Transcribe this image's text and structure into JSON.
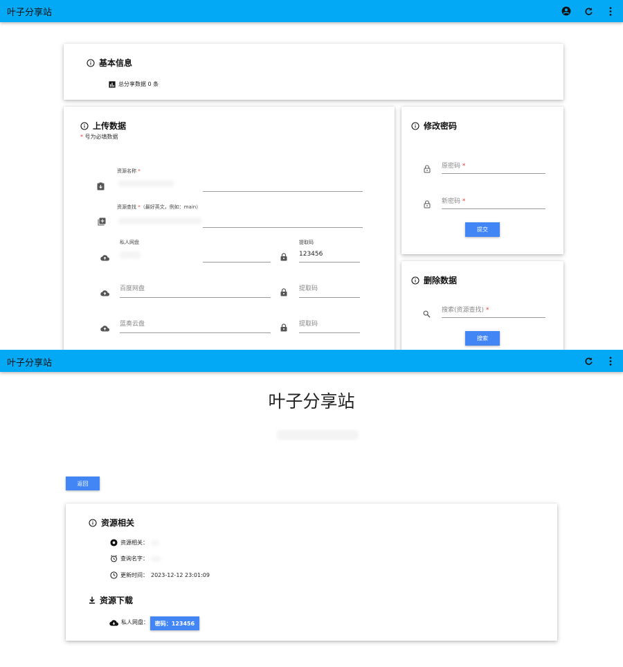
{
  "app": {
    "title": "叶子分享站"
  },
  "admin": {
    "basic": {
      "title": "基本信息",
      "total_label": "总分享数据 0 条"
    },
    "upload": {
      "title": "上传数据",
      "required_note_star": "*",
      "required_note": "号为必填数据",
      "resource_name_label": "资源名称",
      "resource_find_label": "资源查找",
      "resource_find_hint": "（最好英文，例如：main）",
      "private_disk_label": "私人网盘",
      "code_label": "提取码",
      "code_value": "123456",
      "baidu_placeholder": "百度网盘",
      "baidu_code_placeholder": "提取码",
      "lanzou_placeholder": "蓝奏云盘",
      "lanzou_code_placeholder": "提取码"
    },
    "password": {
      "title": "修改密码",
      "old_placeholder": "原密码",
      "new_placeholder": "新密码",
      "submit_label": "提交"
    },
    "delete": {
      "title": "删除数据",
      "search_placeholder": "搜索(资源查找)",
      "search_label": "搜索"
    }
  },
  "viewer": {
    "heading": "叶子分享站",
    "back_label": "返回",
    "resource": {
      "title": "资源相关",
      "related_label": "资源相关：",
      "query_label": "查询名字：",
      "updated_label": "更新时间：",
      "updated_value": "2023-12-12 23:01:09"
    },
    "download": {
      "title": "资源下载",
      "private_label": "私人网盘：",
      "code_button": "密码：123456"
    }
  },
  "colors": {
    "appbar": "#03a9f4",
    "button": "#4285f4",
    "required": "#e53935"
  }
}
